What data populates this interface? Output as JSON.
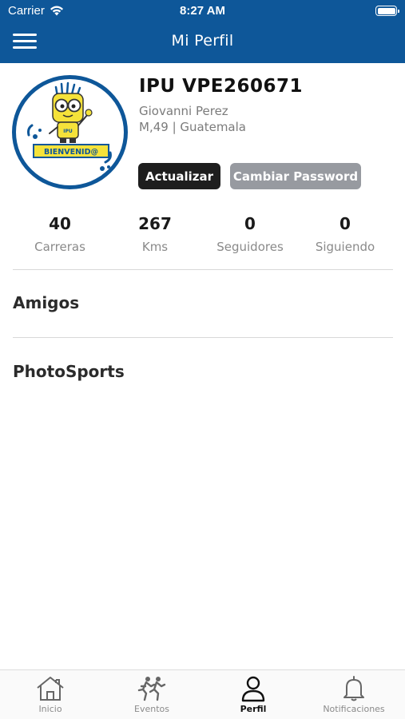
{
  "status_bar": {
    "carrier": "Carrier",
    "time": "8:27 AM"
  },
  "nav": {
    "title": "Mi Perfil"
  },
  "profile": {
    "username": "IPU VPE260671",
    "full_name": "Giovanni Perez",
    "details": "M,49 | Guatemala",
    "avatar_text": "BIENVENID@",
    "avatar_badge": "IPU"
  },
  "actions": {
    "update_label": "Actualizar",
    "password_label": "Cambiar Password"
  },
  "stats": [
    {
      "value": "40",
      "label": "Carreras"
    },
    {
      "value": "267",
      "label": "Kms"
    },
    {
      "value": "0",
      "label": "Seguidores"
    },
    {
      "value": "0",
      "label": "Siguiendo"
    }
  ],
  "sections": {
    "friends": "Amigos",
    "photos": "PhotoSports"
  },
  "tabs": [
    {
      "label": "Inicio",
      "icon": "home-icon"
    },
    {
      "label": "Eventos",
      "icon": "runners-icon"
    },
    {
      "label": "Perfil",
      "icon": "person-icon"
    },
    {
      "label": "Notificaciones",
      "icon": "bell-icon"
    }
  ],
  "colors": {
    "primary": "#0e5799",
    "button_dark": "#1e1e1e",
    "button_gray": "#979aa0",
    "mascot_yellow": "#f5e23a"
  }
}
